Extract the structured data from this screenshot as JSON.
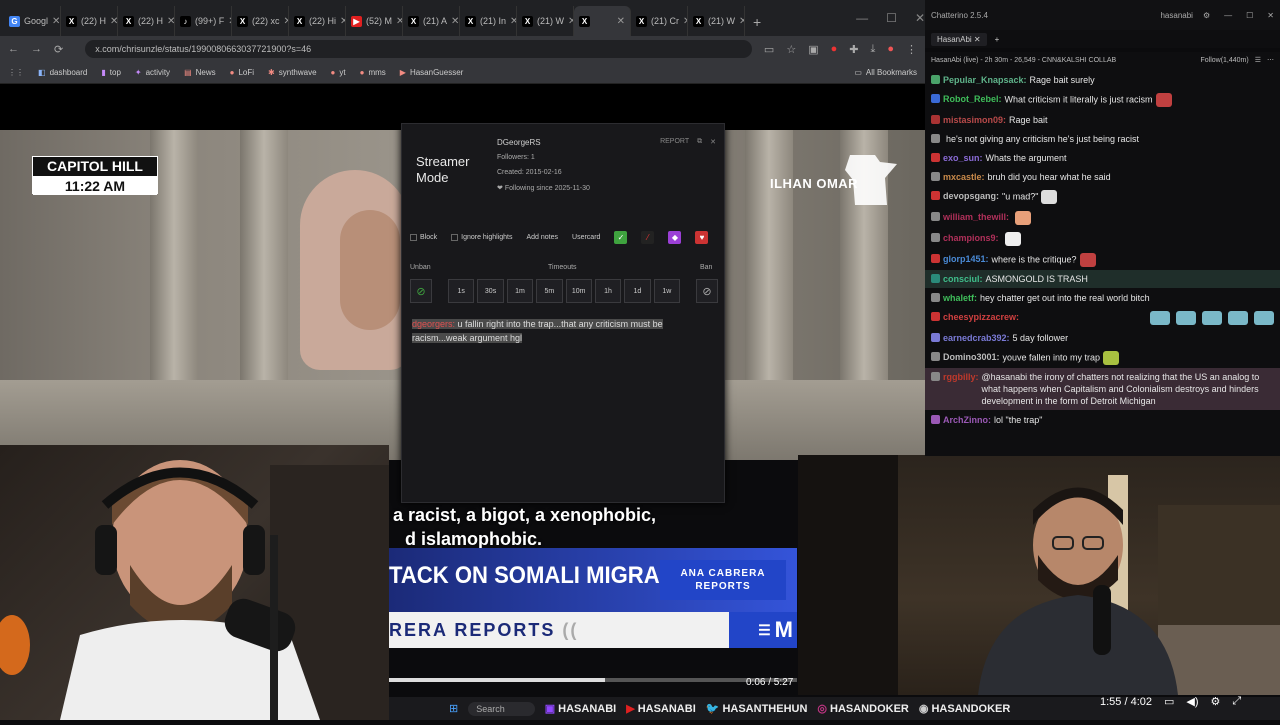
{
  "browser": {
    "tabs": [
      {
        "label": "Googl",
        "icon": "G",
        "color": "#4285f4"
      },
      {
        "label": "(22) H",
        "icon": "X",
        "color": "#000"
      },
      {
        "label": "(22) H",
        "icon": "X",
        "color": "#000"
      },
      {
        "label": "(99+) F",
        "icon": "♪",
        "color": "#000"
      },
      {
        "label": "(22) xc",
        "icon": "X",
        "color": "#000"
      },
      {
        "label": "(22) Hi",
        "icon": "X",
        "color": "#000"
      },
      {
        "label": "(52) M",
        "icon": "▶",
        "color": "#e02020"
      },
      {
        "label": "(21) A",
        "icon": "X",
        "color": "#000"
      },
      {
        "label": "(21) In",
        "icon": "X",
        "color": "#000"
      },
      {
        "label": "(21) W",
        "icon": "X",
        "color": "#000"
      },
      {
        "label": "",
        "icon": "X",
        "color": "#000",
        "active": true
      },
      {
        "label": "(21) Cr",
        "icon": "X",
        "color": "#000"
      },
      {
        "label": "(21) W",
        "icon": "X",
        "color": "#000"
      }
    ],
    "url": "x.com/chrisunzle/status/1990080663037721900?s=46",
    "bookmarks": [
      "dashboard",
      "top",
      "activity",
      "News",
      "LoFi",
      "synthwave",
      "yt",
      "mms",
      "HasanGuesser"
    ],
    "all_bookmarks": "All Bookmarks"
  },
  "news": {
    "location": "CAPITOL HILL",
    "time": "11:22 AM",
    "name_tag": "ILHAN OMAR",
    "subtitle_line1": "a racist, a bigot, a xenophobic,",
    "subtitle_line2": "d islamophobic.",
    "headline": "TACK ON SOMALI MIGRANTS",
    "show_box": "ANA CABRERA REPORTS",
    "show_bar": "RERA REPORTS",
    "network_fragment": "M",
    "video_time": "0:06 / 5:27",
    "video_progress": 0.53
  },
  "popup": {
    "title": "Streamer Mode",
    "username": "DGeorgeRS",
    "followers": "Followers: 1",
    "created": "Created: 2015-02-16",
    "following_since": "Following since 2025-11-30",
    "top_right": "REPORT",
    "actions": {
      "block": "Block",
      "ignore": "Ignore highlights",
      "add_notes": "Add notes",
      "usercard": "Usercard"
    },
    "unban_label": "Unban",
    "timeouts_label": "Timeouts",
    "ban_label": "Ban",
    "timeouts": [
      "1s",
      "30s",
      "1m",
      "5m",
      "10m",
      "1h",
      "1d",
      "1w"
    ],
    "message_user": "dgeorgers:",
    "message_text": "u fallin right into the trap...that any criticism must be racism...weak argument hgl"
  },
  "chat": {
    "app_title": "Chatterino 2.5.4",
    "account": "hasanabi",
    "tab": "HasanAbi",
    "stream_info": "HasanAbi (live) - 2h 30m - 26,549 - CNN&KALSHI COLLAB",
    "follow": "Follow(1,440m)",
    "messages": [
      {
        "user": "Pepular_Knapsack:",
        "color": "#5fb38a",
        "text": "Rage bait surely"
      },
      {
        "user": "Robot_Rebel:",
        "color": "#3fbd5a",
        "text": "What criticism it literally is just racism"
      },
      {
        "user": "mistasimon09:",
        "color": "#b84a4a",
        "text": "Rage bait"
      },
      {
        "user": "",
        "color": "#c0392b",
        "text": "he's not giving any criticism he's just being racist"
      },
      {
        "user": "exo_sun:",
        "color": "#8a6bd6",
        "text": "Whats the argument"
      },
      {
        "user": "mxcastle:",
        "color": "#c98a4a",
        "text": "bruh did you hear what he said"
      },
      {
        "user": "devopsgang:",
        "color": "#bbbbbb",
        "text": "\"u mad?\""
      },
      {
        "user": "william_thewill:",
        "color": "#b0305a",
        "text": ""
      },
      {
        "user": "champions9:",
        "color": "#b0305a",
        "text": ""
      },
      {
        "user": "glorp1451:",
        "color": "#4a8ad6",
        "text": "where is the critique?"
      },
      {
        "user": "consciul:",
        "color": "#3fbd8a",
        "text": "ASMONGOLD IS TRASH"
      },
      {
        "user": "whaletf:",
        "color": "#3fbd5a",
        "text": "hey chatter get out into the real world bitch"
      },
      {
        "user": "cheesypizzacrew:",
        "color": "#d04040",
        "text": ""
      },
      {
        "user": "earnedcrab392:",
        "color": "#7a7ad6",
        "text": "5 day follower"
      },
      {
        "user": "Domino3001:",
        "color": "#bbbbbb",
        "text": "youve fallen into my trap"
      },
      {
        "user": "rggbilly:",
        "color": "#c0392b",
        "text": "@hasanabi the irony of chatters not realizing that the US an analog to what happens when Capitalism and Colonialism destroys and hinders development in the form of Detroit Michigan"
      },
      {
        "user": "ArchZinno:",
        "color": "#9b59b6",
        "text": "lol \"the trap\""
      }
    ]
  },
  "bottom": {
    "socials": [
      "HASANABI",
      "HASANABI",
      "HASANTHEHUN",
      "HASANDOKER",
      "HASANDOKER"
    ],
    "yt_time": "1:55 / 4:02",
    "search_label": "Search"
  }
}
